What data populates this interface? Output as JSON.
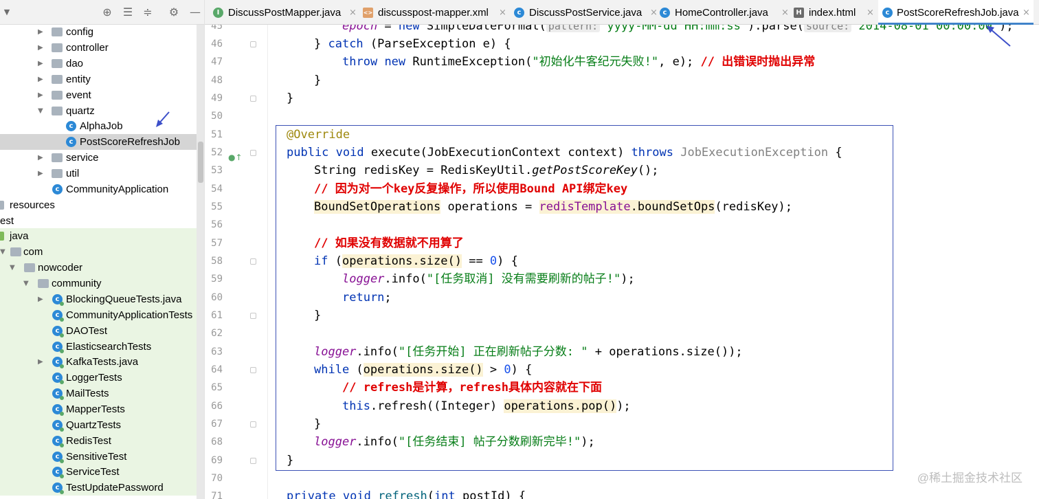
{
  "toolbar": {
    "icons": [
      "target-icon",
      "expand-all-icon",
      "collapse-all-icon",
      "gear-icon",
      "minimize-icon"
    ]
  },
  "sidebar": {
    "items": [
      {
        "label": "config",
        "type": "folder"
      },
      {
        "label": "controller",
        "type": "folder"
      },
      {
        "label": "dao",
        "type": "folder"
      },
      {
        "label": "entity",
        "type": "folder"
      },
      {
        "label": "event",
        "type": "folder"
      },
      {
        "label": "quartz",
        "type": "folder",
        "expanded": true
      },
      {
        "label": "AlphaJob",
        "type": "class"
      },
      {
        "label": "PostScoreRefreshJob",
        "type": "class",
        "selected": true
      },
      {
        "label": "service",
        "type": "folder"
      },
      {
        "label": "util",
        "type": "folder"
      },
      {
        "label": "CommunityApplication",
        "type": "class"
      },
      {
        "label": "resources",
        "type": "folder"
      },
      {
        "label": "est",
        "type": "folder"
      },
      {
        "label": "java",
        "type": "folder"
      },
      {
        "label": "com",
        "type": "folder"
      },
      {
        "label": "nowcoder",
        "type": "folder"
      },
      {
        "label": "community",
        "type": "folder"
      },
      {
        "label": "BlockingQueueTests.java",
        "type": "test"
      },
      {
        "label": "CommunityApplicationTests",
        "type": "test"
      },
      {
        "label": "DAOTest",
        "type": "test"
      },
      {
        "label": "ElasticsearchTests",
        "type": "test"
      },
      {
        "label": "KafkaTests.java",
        "type": "test"
      },
      {
        "label": "LoggerTests",
        "type": "test"
      },
      {
        "label": "MailTests",
        "type": "test"
      },
      {
        "label": "MapperTests",
        "type": "test"
      },
      {
        "label": "QuartzTests",
        "type": "test"
      },
      {
        "label": "RedisTest",
        "type": "test"
      },
      {
        "label": "SensitiveTest",
        "type": "test"
      },
      {
        "label": "ServiceTest",
        "type": "test"
      },
      {
        "label": "TestUpdatePassword",
        "type": "test"
      }
    ]
  },
  "tabs": [
    {
      "label": "DiscussPostMapper.java",
      "icon": "I"
    },
    {
      "label": "discusspost-mapper.xml",
      "icon": "xml"
    },
    {
      "label": "DiscussPostService.java",
      "icon": "C"
    },
    {
      "label": "HomeController.java",
      "icon": "C"
    },
    {
      "label": "index.html",
      "icon": "H"
    },
    {
      "label": "PostScoreRefreshJob.java",
      "icon": "C",
      "active": true
    }
  ],
  "editor": {
    "line_numbers": [
      "45",
      "46",
      "47",
      "48",
      "49",
      "50",
      "51",
      "52",
      "53",
      "54",
      "55",
      "56",
      "57",
      "58",
      "59",
      "60",
      "61",
      "62",
      "63",
      "64",
      "65",
      "66",
      "67",
      "68",
      "69",
      "70",
      "71"
    ],
    "code": {
      "l45a": "epoch",
      "l45b": " = ",
      "l45c": "new",
      "l45d": " SimpleDateFormat(",
      "l45e": "pattern:",
      "l45f": "\"yyyy-MM-dd HH:mm:ss\"",
      "l45g": ").parse(",
      "l45h": "source:",
      "l45i": "\"2014-08-01 00:00:00\"",
      "l45j": ");",
      "l46a": "} ",
      "l46b": "catch",
      "l46c": " (ParseException e) {",
      "l47a": "throw",
      "l47b": " ",
      "l47c": "new",
      "l47d": " RuntimeException(",
      "l47e": "\"初始化牛客纪元失败!\"",
      "l47f": ", e); ",
      "l47g": "// 出错误时抛出异常",
      "l48": "}",
      "l49": "}",
      "l51": "@Override",
      "l52a": "public",
      "l52b": " ",
      "l52c": "void",
      "l52d": " execute(JobExecutionContext context) ",
      "l52e": "throws",
      "l52f": " JobExecutionException",
      "l52g": " {",
      "l53a": "String redisKey = RedisKeyUtil.",
      "l53b": "getPostScoreKey",
      "l53c": "();",
      "l54": "// 因为对一个key反复操作，所以使用Bound API绑定key",
      "l55a": "BoundSetOperations",
      "l55b": " operations = ",
      "l55c": "redisTemplate",
      "l55d": ".boundSetOps",
      "l55e": "(redisKey);",
      "l57": "// 如果没有数据就不用算了",
      "l58a": "if",
      "l58b": " (",
      "l58c": "operations.size()",
      "l58d": " == ",
      "l58e": "0",
      "l58f": ") {",
      "l59a": "logger",
      "l59b": ".info(",
      "l59c": "\"[任务取消] 没有需要刷新的帖子!\"",
      "l59d": ");",
      "l60a": "return",
      "l60b": ";",
      "l61": "}",
      "l63a": "logger",
      "l63b": ".info(",
      "l63c": "\"[任务开始] 正在刷新帖子分数: \"",
      "l63d": " + operations.size());",
      "l64a": "while",
      "l64b": " (",
      "l64c": "operations.size()",
      "l64d": " > ",
      "l64e": "0",
      "l64f": ") {",
      "l65": "// refresh是计算，refresh具体内容就在下面",
      "l66a": "this",
      "l66b": ".refresh((Integer) ",
      "l66c": "operations.pop()",
      "l66d": ");",
      "l67": "}",
      "l68a": "logger",
      "l68b": ".info(",
      "l68c": "\"[任务结束] 帖子分数刷新完毕!\"",
      "l68d": ");",
      "l69": "}",
      "l71a": "private",
      "l71b": " ",
      "l71c": "void",
      "l71d": " ",
      "l71e": "refresh",
      "l71f": "(",
      "l71g": "int",
      "l71h": " postId) {"
    }
  },
  "watermark": "@稀土掘金技术社区",
  "colors": {
    "keyword": "#0033b3",
    "string": "#067d17",
    "comment": "#e00000",
    "annotation": "#9e880d",
    "frame": "#3c52b5",
    "active_tab_underline": "#4083c9",
    "test_tree_background": "#eaf5e3"
  }
}
